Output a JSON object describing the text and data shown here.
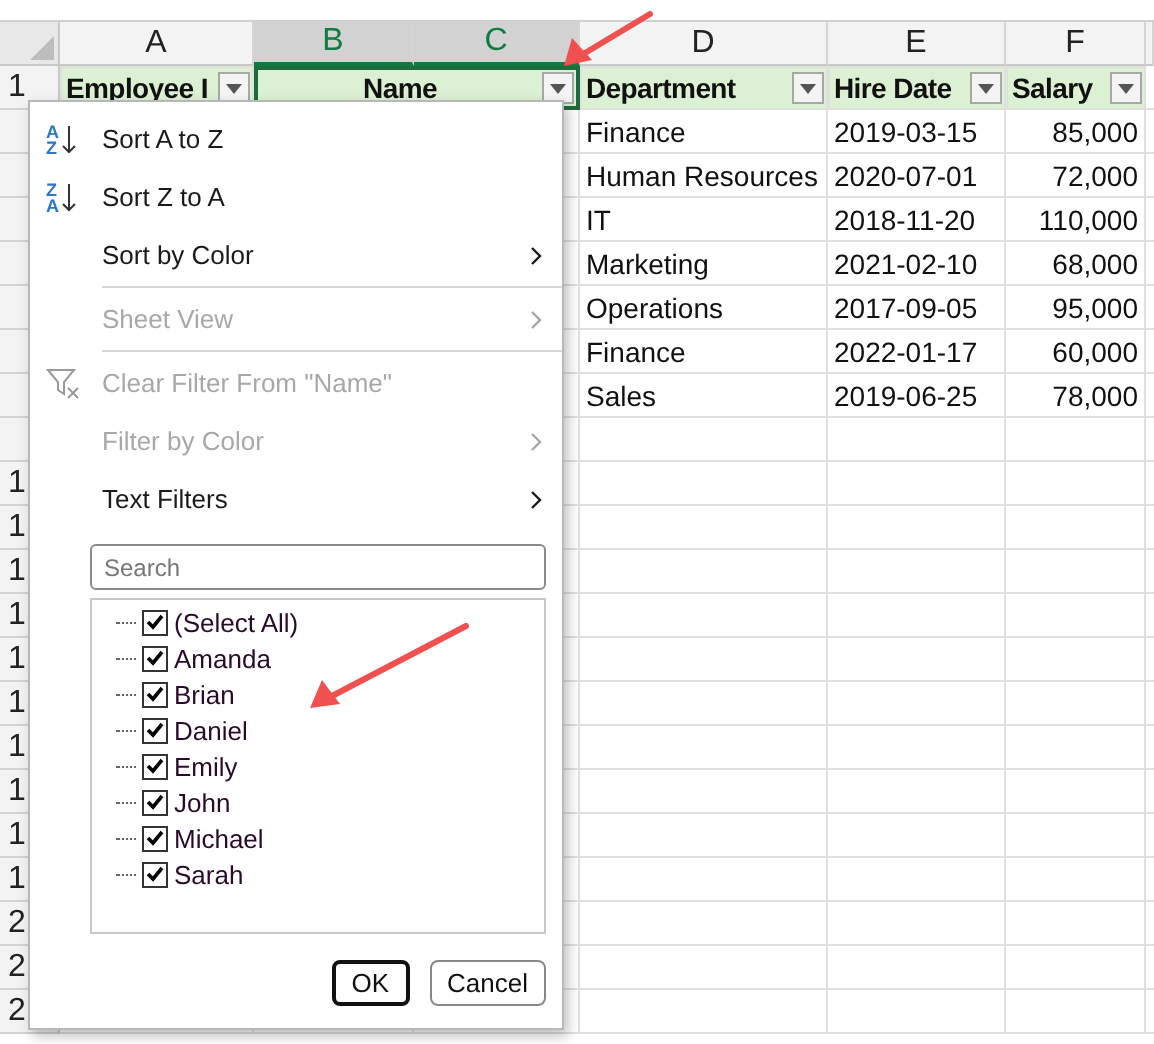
{
  "columns": [
    {
      "label": "A",
      "selected": false
    },
    {
      "label": "B",
      "selected": true
    },
    {
      "label": "C",
      "selected": true
    },
    {
      "label": "D",
      "selected": false
    },
    {
      "label": "E",
      "selected": false
    },
    {
      "label": "F",
      "selected": false
    }
  ],
  "header_row_number": "1",
  "header_row": [
    {
      "text": "Employee I",
      "merged": false,
      "selected": false
    },
    {
      "text": "Name",
      "merged": true,
      "selected": true
    },
    {
      "text": "Department",
      "merged": false,
      "selected": false
    },
    {
      "text": "Hire Date",
      "merged": false,
      "selected": false
    },
    {
      "text": "Salary",
      "merged": false,
      "selected": false
    }
  ],
  "lower_row_headers": [
    "1",
    "1",
    "1",
    "1",
    "1",
    "1",
    "1",
    "1",
    "1",
    "1",
    "2",
    "2",
    "2"
  ],
  "data_rows": [
    {
      "department": "Finance",
      "hire_date": "2019-03-15",
      "salary": "85,000"
    },
    {
      "department": "Human Resources",
      "hire_date": "2020-07-01",
      "salary": "72,000"
    },
    {
      "department": "IT",
      "hire_date": "2018-11-20",
      "salary": "110,000"
    },
    {
      "department": "Marketing",
      "hire_date": "2021-02-10",
      "salary": "68,000"
    },
    {
      "department": "Operations",
      "hire_date": "2017-09-05",
      "salary": "95,000"
    },
    {
      "department": "Finance",
      "hire_date": "2022-01-17",
      "salary": "60,000"
    },
    {
      "department": "Sales",
      "hire_date": "2019-06-25",
      "salary": "78,000"
    }
  ],
  "filter_menu": {
    "items": [
      {
        "kind": "sort",
        "label": "Sort A to Z",
        "icon_letters": [
          "A",
          "Z"
        ],
        "disabled": false,
        "submenu": false
      },
      {
        "kind": "sort",
        "label": "Sort Z to A",
        "icon_letters": [
          "Z",
          "A"
        ],
        "disabled": false,
        "submenu": false
      },
      {
        "kind": "plain",
        "label": "Sort by Color",
        "disabled": false,
        "submenu": true
      },
      {
        "kind": "separator"
      },
      {
        "kind": "plain",
        "label": "Sheet View",
        "disabled": true,
        "submenu": true
      },
      {
        "kind": "separator"
      },
      {
        "kind": "clear",
        "label": "Clear Filter From \"Name\"",
        "disabled": true,
        "submenu": false
      },
      {
        "kind": "plain",
        "label": "Filter by Color",
        "disabled": true,
        "submenu": true
      },
      {
        "kind": "plain",
        "label": "Text Filters",
        "disabled": false,
        "submenu": true
      }
    ],
    "search": {
      "placeholder": "Search"
    },
    "values": [
      {
        "label": "(Select All)",
        "checked": true
      },
      {
        "label": "Amanda",
        "checked": true
      },
      {
        "label": "Brian",
        "checked": true
      },
      {
        "label": "Daniel",
        "checked": true
      },
      {
        "label": "Emily",
        "checked": true
      },
      {
        "label": "John",
        "checked": true
      },
      {
        "label": "Michael",
        "checked": true
      },
      {
        "label": "Sarah",
        "checked": true
      }
    ],
    "buttons": [
      {
        "label": "OK",
        "default": true
      },
      {
        "label": "Cancel",
        "default": false
      }
    ]
  }
}
